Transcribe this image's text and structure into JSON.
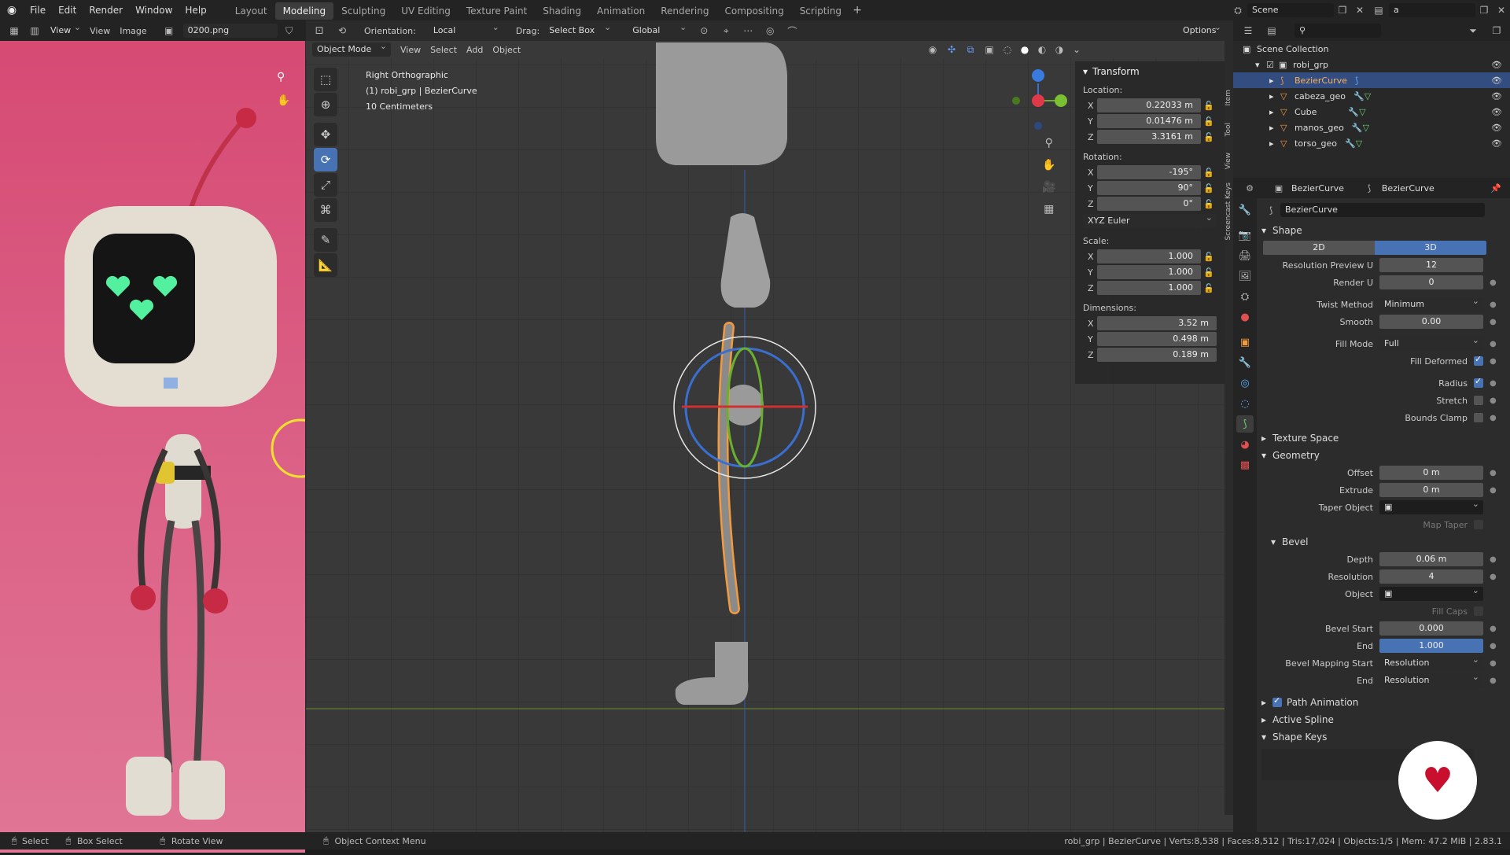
{
  "menu": {
    "items": [
      "File",
      "Edit",
      "Render",
      "Window",
      "Help"
    ]
  },
  "workspaces": [
    "Layout",
    "Modeling",
    "Sculpting",
    "UV Editing",
    "Texture Paint",
    "Shading",
    "Animation",
    "Rendering",
    "Compositing",
    "Scripting"
  ],
  "active_workspace": "Modeling",
  "scene_name": "Scene",
  "viewlayer_name": "a",
  "image_editor": {
    "view": "View",
    "view2": "View",
    "image_menu": "Image",
    "image_name": "0200.png"
  },
  "viewport": {
    "orientation_label": "Orientation:",
    "orientation": "Local",
    "drag_label": "Drag:",
    "drag": "Select Box",
    "transform_space": "Global",
    "options": "Options",
    "mode": "Object Mode",
    "menus": [
      "View",
      "Select",
      "Add",
      "Object"
    ],
    "info_line1": "Right Orthographic",
    "info_line2": "(1) robi_grp | BezierCurve",
    "info_line3": "10 Centimeters"
  },
  "npanel": {
    "title": "Transform",
    "location_label": "Location:",
    "location": {
      "x": "0.22033 m",
      "y": "0.01476 m",
      "z": "3.3161 m"
    },
    "rotation_label": "Rotation:",
    "rotation": {
      "x": "-195°",
      "y": "90°",
      "z": "0°"
    },
    "rotation_mode": "XYZ Euler",
    "scale_label": "Scale:",
    "scale": {
      "x": "1.000",
      "y": "1.000",
      "z": "1.000"
    },
    "dimensions_label": "Dimensions:",
    "dimensions": {
      "x": "3.52 m",
      "y": "0.498 m",
      "z": "0.189 m"
    },
    "axes": {
      "x": "X",
      "y": "Y",
      "z": "Z"
    },
    "tabs": [
      "Item",
      "Tool",
      "View",
      "Screencast Keys"
    ]
  },
  "outliner": {
    "root": "Scene Collection",
    "items": [
      "robi_grp",
      "BezierCurve",
      "cabeza_geo",
      "Cube",
      "manos_geo",
      "torso_geo"
    ]
  },
  "properties": {
    "object_name": "BezierCurve",
    "data_name": "BezierCurve",
    "datablock": "BezierCurve",
    "shape_section": "Shape",
    "btn_2d": "2D",
    "btn_3d": "3D",
    "res_preview_label": "Resolution Preview U",
    "res_preview": "12",
    "render_u_label": "Render U",
    "render_u": "0",
    "twist_method_label": "Twist Method",
    "twist_method": "Minimum",
    "smooth_label": "Smooth",
    "smooth": "0.00",
    "fill_mode_label": "Fill Mode",
    "fill_mode": "Full",
    "fill_deformed_label": "Fill Deformed",
    "radius_label": "Radius",
    "stretch_label": "Stretch",
    "bounds_clamp_label": "Bounds Clamp",
    "texture_space": "Texture Space",
    "geometry": "Geometry",
    "offset_label": "Offset",
    "offset": "0 m",
    "extrude_label": "Extrude",
    "extrude": "0 m",
    "taper_label": "Taper Object",
    "map_taper_label": "Map Taper",
    "bevel": "Bevel",
    "depth_label": "Depth",
    "depth": "0.06 m",
    "resolution_label": "Resolution",
    "resolution": "4",
    "object_label": "Object",
    "fill_caps_label": "Fill Caps",
    "bevel_start_label": "Bevel Start",
    "bevel_start": "0.000",
    "end_label": "End",
    "bevel_end": "1.000",
    "bevel_mapping_label": "Bevel Mapping Start",
    "bevel_mapping_start": "Resolution",
    "bevel_mapping_end_label": "End",
    "bevel_mapping_end": "Resolution",
    "path_animation": "Path Animation",
    "active_spline": "Active Spline",
    "shape_keys": "Shape Keys"
  },
  "statusbar": {
    "select": "Select",
    "box_select": "Box Select",
    "rotate_view": "Rotate View",
    "context_menu": "Object Context Menu",
    "stats": "robi_grp | BezierCurve | Verts:8,538 | Faces:8,512 | Tris:17,024 | Objects:1/5 | Mem: 47.2 MiB | 2.83.1"
  },
  "colors": {
    "accent": "#4772b3",
    "selection_orange": "#f29a3f",
    "canvas_pink": "#d9557a",
    "screen_green": "#53f0a0"
  }
}
